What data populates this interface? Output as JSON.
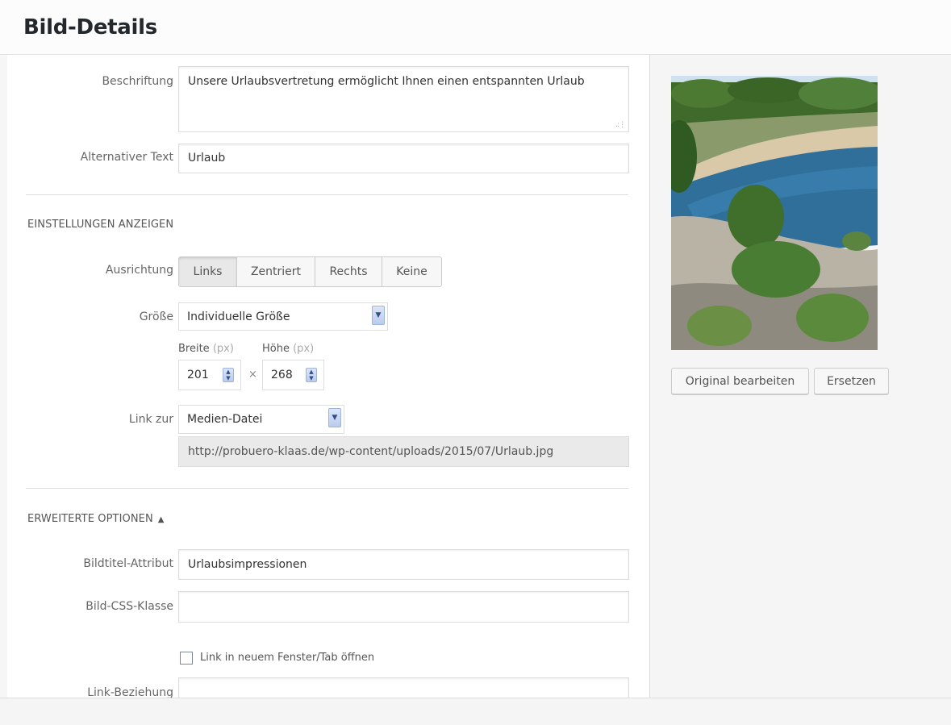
{
  "header": {
    "title": "Bild-Details"
  },
  "form": {
    "caption": {
      "label": "Beschriftung",
      "value": "Unsere Urlaubsvertretung ermöglicht Ihnen einen entspannten Urlaub"
    },
    "alt_text": {
      "label": "Alternativer Text",
      "value": "Urlaub"
    }
  },
  "display_settings": {
    "title": "EINSTELLUNGEN ANZEIGEN",
    "alignment": {
      "label": "Ausrichtung",
      "options": [
        "Links",
        "Zentriert",
        "Rechts",
        "Keine"
      ],
      "selected": "Links"
    },
    "size": {
      "label": "Größe",
      "value": "Individuelle Größe",
      "width_label": "Breite",
      "height_label": "Höhe",
      "unit": "(px)",
      "width": "201",
      "height": "268",
      "separator": "×"
    },
    "link": {
      "label": "Link zur",
      "value": "Medien-Datei",
      "url": "http://probuero-klaas.de/wp-content/uploads/2015/07/Urlaub.jpg"
    }
  },
  "advanced": {
    "title": "ERWEITERTE OPTIONEN",
    "title_attr": {
      "label": "Bildtitel-Attribut",
      "value": "Urlaubsimpressionen"
    },
    "css_class": {
      "label": "Bild-CSS-Klasse",
      "value": ""
    },
    "new_tab": {
      "label": "Link in neuem Fenster/Tab öffnen",
      "checked": false
    },
    "link_rel": {
      "label": "Link-Beziehung",
      "value": ""
    }
  },
  "sidebar": {
    "edit_button": "Original bearbeiten",
    "replace_button": "Ersetzen"
  },
  "icons": {
    "caret": "caret-up-icon",
    "dropdown": "chevron-down-icon",
    "spinner": "spinner-arrows-icon"
  }
}
